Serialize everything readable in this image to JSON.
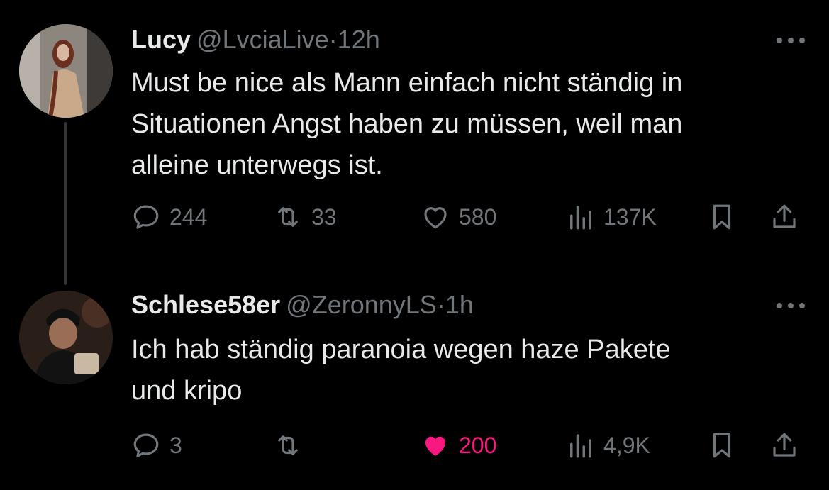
{
  "colors": {
    "background": "#000000",
    "text": "#e7e9ea",
    "muted": "#71767b",
    "like_active": "#f91880"
  },
  "tweets": [
    {
      "name": "Lucy",
      "handle": "@LvciaLive",
      "separator": "·",
      "time": "12h",
      "text_lines": [
        "Must be nice als Mann einfach nicht ständig in",
        "Situationen Angst haben zu müssen, weil man",
        "alleine unterwegs ist."
      ],
      "replies": "244",
      "retweets": "33",
      "likes": "580",
      "views": "137K",
      "liked": false,
      "icons": [
        "reply-icon",
        "retweet-icon",
        "heart-icon",
        "views-icon",
        "bookmark-icon",
        "share-icon"
      ]
    },
    {
      "name": "Schlese58er",
      "handle": "@ZeronnyLS",
      "separator": "·",
      "time": "1h",
      "text_lines": [
        "Ich hab ständig paranoia wegen haze Pakete",
        "und kripo"
      ],
      "replies": "3",
      "retweets": "",
      "likes": "200",
      "views": "4,9K",
      "liked": true,
      "icons": [
        "reply-icon",
        "retweet-icon",
        "heart-filled-icon",
        "views-icon",
        "bookmark-icon",
        "share-icon"
      ]
    }
  ]
}
